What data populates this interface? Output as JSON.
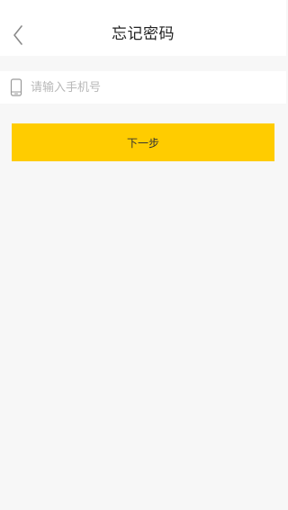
{
  "header": {
    "title": "忘记密码",
    "back_icon": "chevron-left-icon"
  },
  "form": {
    "phone": {
      "icon": "mobile-phone-icon",
      "placeholder": "请输入手机号",
      "value": ""
    },
    "next_label": "下一步"
  },
  "colors": {
    "background": "#f7f7f7",
    "surface": "#ffffff",
    "accent": "#ffcc00",
    "placeholder": "#b8b8b8",
    "icon": "#999999"
  }
}
